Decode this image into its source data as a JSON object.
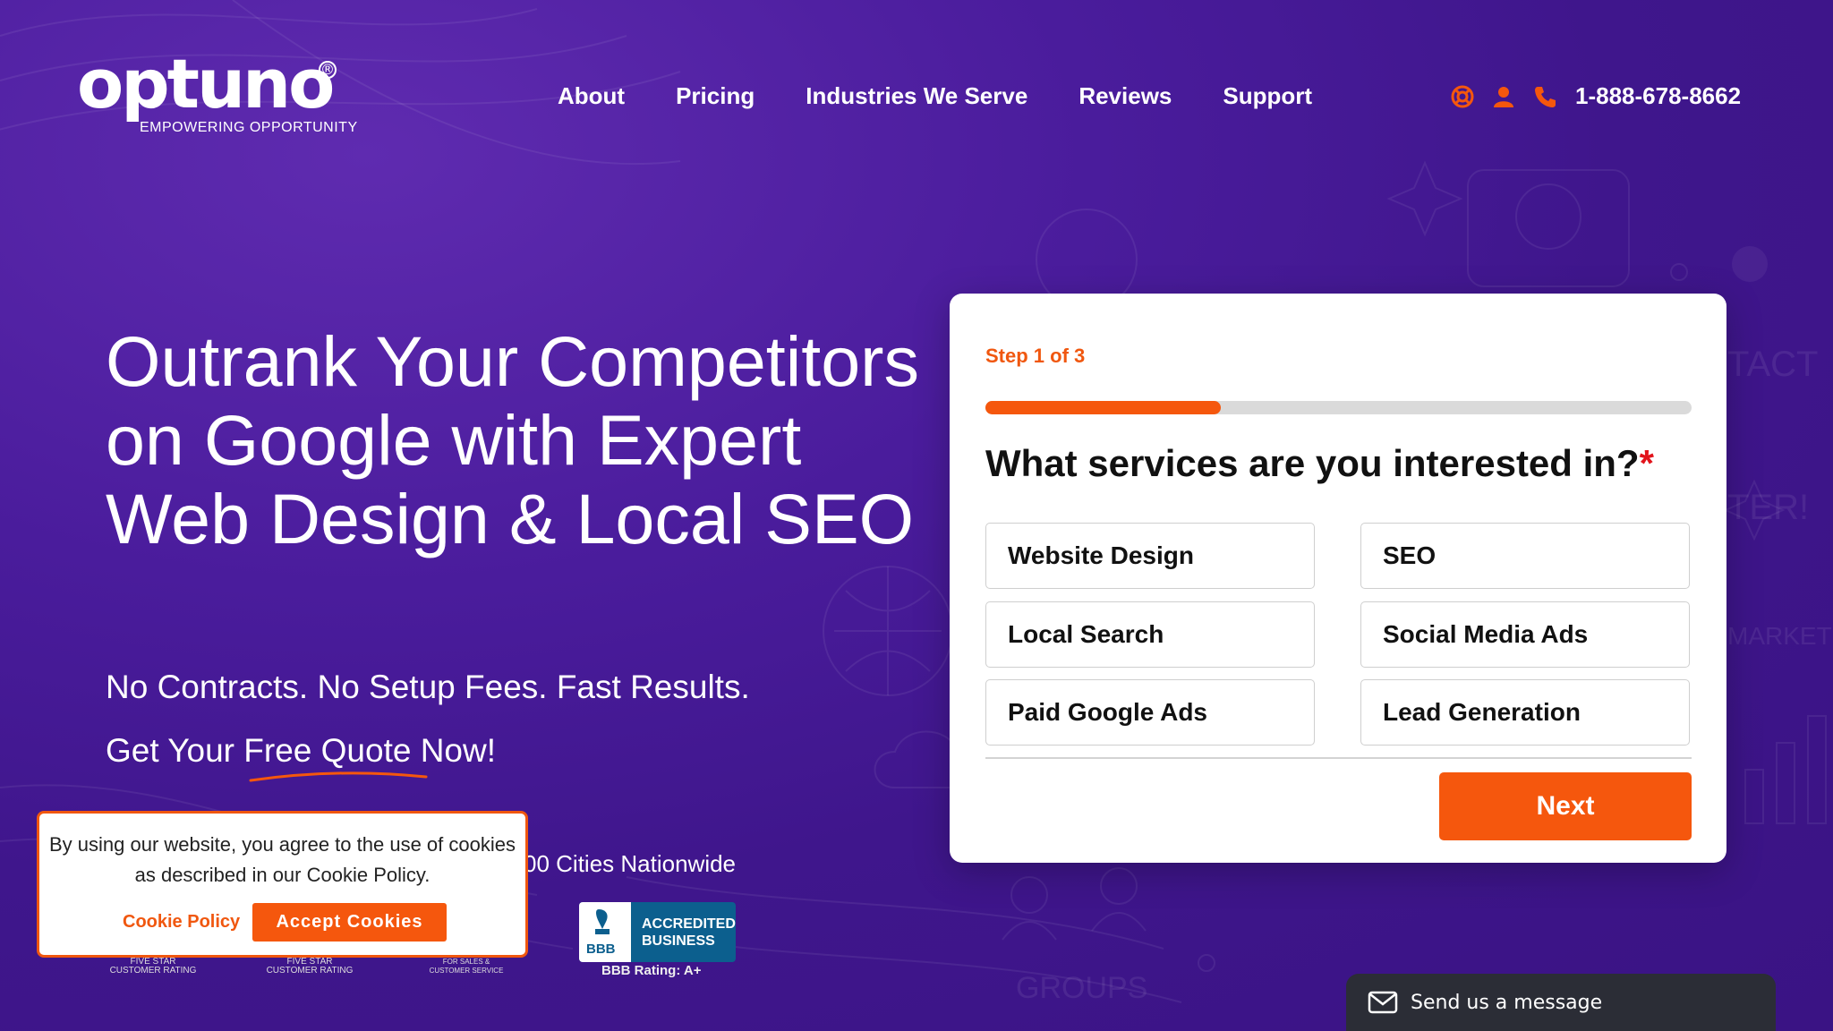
{
  "brand": {
    "name": "optuno",
    "tagline": "EMPOWERING OPPORTUNITY",
    "registered": "®"
  },
  "nav": {
    "items": [
      "About",
      "Pricing",
      "Industries We Serve",
      "Reviews",
      "Support"
    ]
  },
  "contact": {
    "icons": [
      "support-icon",
      "user-icon",
      "phone-icon"
    ],
    "phone": "1-888-678-8662"
  },
  "hero": {
    "title": "Outrank Your Competitors on Google with Expert Web Design & Local SEO",
    "subtitle": "No Contracts. No Setup Fees. Fast Results.",
    "cta": "Get Your Free Quote Now!",
    "cities_partial": "00 Cities Nationwide"
  },
  "badges": {
    "five_star_1": "FIVE STAR CUSTOMER RATING",
    "five_star_2": "FIVE STAR CUSTOMER RATING",
    "award": "FOR SALES & CUSTOMER SERVICE",
    "bbb_mark": "BBB",
    "bbb_accredited": "ACCREDITED",
    "bbb_business": "BUSINESS",
    "bbb_rating": "BBB Rating: A+"
  },
  "form": {
    "step": "Step 1 of 3",
    "progress": 0.333,
    "question": "What services are you interested in?",
    "required_mark": "*",
    "options": [
      "Website Design",
      "SEO",
      "Local Search",
      "Social Media Ads",
      "Paid Google Ads",
      "Lead Generation"
    ],
    "next_label": "Next"
  },
  "cookie": {
    "message": "By using our website, you agree to the use of cookies as described in our Cookie Policy.",
    "policy_link": "Cookie Policy",
    "accept_label": "Accept Cookies"
  },
  "chat": {
    "label": "Send us a message"
  },
  "colors": {
    "accent": "#f5570d",
    "background": "#4a1c9c",
    "chat_bg": "#2b2d36",
    "bbb_blue": "#0c5f8e"
  }
}
